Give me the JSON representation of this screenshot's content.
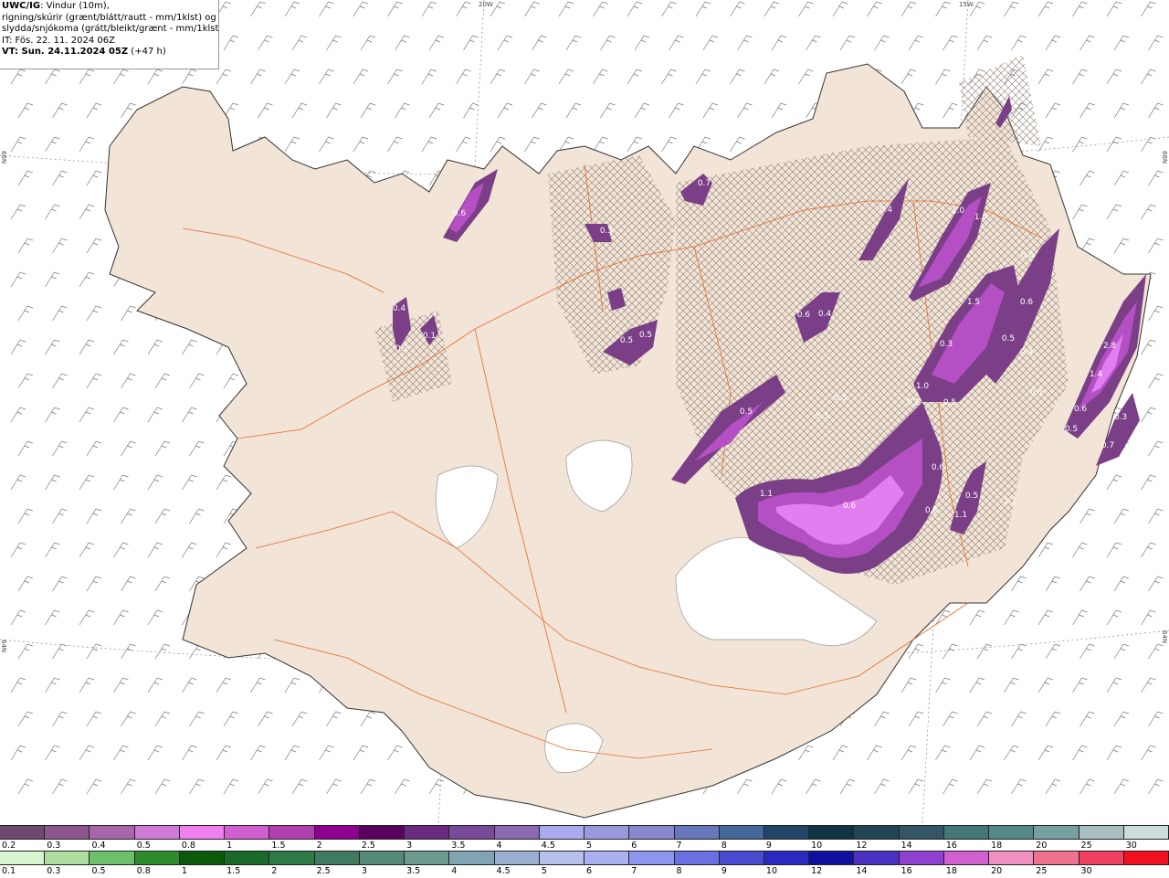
{
  "header": {
    "product_code": "UWC/IG",
    "line1_rest": ": Vindur (10m),",
    "line2": "rigning/skúrir (grænt/blátt/rautt - mm/1klst) og",
    "line3": "slydda/snjókoma (grátt/bleikt/grænt - mm/1klst)",
    "line4": "IT: Fös. 22. 11. 2024 06Z",
    "line5_bold": "VT: Sun. 24.11.2024 05Z",
    "line5_rest": " (+47 h)"
  },
  "coords": {
    "top_20w": "20W",
    "top_15w": "15W",
    "left_66n": "66N",
    "right_66n": "66N",
    "left_64n": "64N",
    "right_64n": "64N"
  },
  "colors": {
    "land": "#f2e4d6",
    "sea": "#ffffff",
    "roads": "#e86a2c",
    "ice": "#ffffff",
    "snow_dark": "#7a3f86",
    "snow_mid": "#b44fc4",
    "snow_light": "#e27ff0"
  },
  "snow_values": [
    "0.6",
    "0.4",
    "0.2",
    "0.1",
    "0.7",
    "0.3",
    "0.4",
    "1.0",
    "0.4",
    "1.0",
    "1.5",
    "0.6",
    "0.4",
    "0.6",
    "0.5",
    "0.5",
    "0.5",
    "0.4",
    "0.5",
    "0.3",
    "0.3",
    "0.3",
    "0.2",
    "0.5",
    "1.0",
    "2.8",
    "1.4",
    "0.6",
    "0.5",
    "0.3",
    "0.7",
    "0.6",
    "0.5",
    "1.1",
    "1.1",
    "0.6",
    "1.1",
    "0.6",
    "0.5"
  ],
  "legend_top": {
    "labels": [
      "0.2",
      "0.3",
      "0.4",
      "0.5",
      "0.8",
      "1",
      "1.5",
      "2",
      "2.5",
      "3",
      "3.5",
      "4",
      "4.5",
      "5",
      "6",
      "7",
      "8",
      "9",
      "10",
      "12",
      "14",
      "16",
      "18",
      "20",
      "25",
      "30"
    ],
    "colors": [
      "#6e4a6e",
      "#8e568e",
      "#a866aa",
      "#cf7ad6",
      "#f080f0",
      "#d060d0",
      "#b040b0",
      "#900090",
      "#5a0060",
      "#6a2a80",
      "#7a4a9a",
      "#8a6ab0",
      "#aaaaee",
      "#9999dd",
      "#8888cc",
      "#6677bb",
      "#446699",
      "#224466",
      "#113344",
      "#224455",
      "#335566",
      "#447777",
      "#558888",
      "#77a0a0",
      "#aac0c0",
      "#ccdddd"
    ]
  },
  "legend_bottom": {
    "labels": [
      "0.1",
      "0.3",
      "0.5",
      "0.8",
      "1",
      "1.5",
      "2",
      "2.5",
      "3",
      "3.5",
      "4",
      "4.5",
      "5",
      "6",
      "7",
      "8",
      "9",
      "10",
      "12",
      "14",
      "16",
      "18",
      "20",
      "25",
      "30"
    ],
    "colors": [
      "#d8f5d0",
      "#aedfa0",
      "#6cc06c",
      "#2e8b2e",
      "#0a5a0a",
      "#1a6a2a",
      "#2d7a45",
      "#407a60",
      "#558a78",
      "#6a9a90",
      "#80a4b4",
      "#9ab0d0",
      "#b6c0ec",
      "#aab0f0",
      "#8c96ec",
      "#6a70e0",
      "#4a4ad0",
      "#2a2ac0",
      "#1010a0",
      "#4a30c0",
      "#9040d0",
      "#d060d0",
      "#f090c0",
      "#f07090",
      "#f04060",
      "#f01020"
    ]
  }
}
